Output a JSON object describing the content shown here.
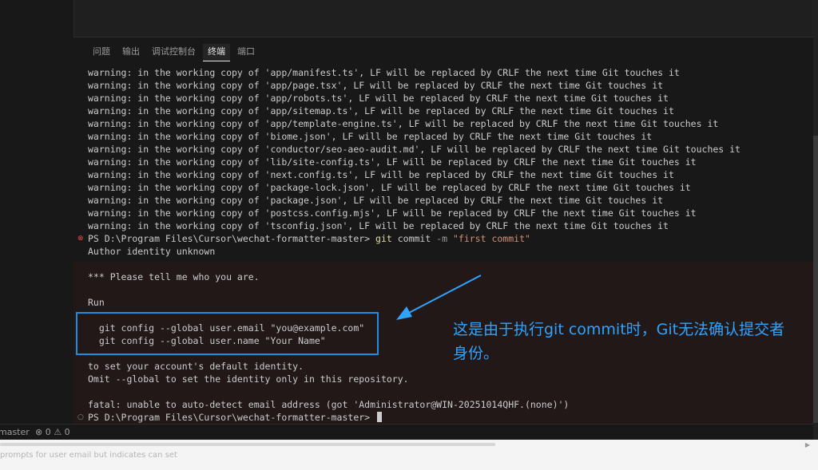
{
  "panel": {
    "tabs": [
      {
        "label": "问题",
        "active": false
      },
      {
        "label": "输出",
        "active": false
      },
      {
        "label": "调试控制台",
        "active": false
      },
      {
        "label": "终端",
        "active": true
      },
      {
        "label": "端口",
        "active": false
      }
    ]
  },
  "terminal": {
    "warnings": [
      "warning: in the working copy of 'app/manifest.ts', LF will be replaced by CRLF the next time Git touches it",
      "warning: in the working copy of 'app/page.tsx', LF will be replaced by CRLF the next time Git touches it",
      "warning: in the working copy of 'app/robots.ts', LF will be replaced by CRLF the next time Git touches it",
      "warning: in the working copy of 'app/sitemap.ts', LF will be replaced by CRLF the next time Git touches it",
      "warning: in the working copy of 'app/template-engine.ts', LF will be replaced by CRLF the next time Git touches it",
      "warning: in the working copy of 'biome.json', LF will be replaced by CRLF the next time Git touches it",
      "warning: in the working copy of 'conductor/seo-aeo-audit.md', LF will be replaced by CRLF the next time Git touches it",
      "warning: in the working copy of 'lib/site-config.ts', LF will be replaced by CRLF the next time Git touches it",
      "warning: in the working copy of 'next.config.ts', LF will be replaced by CRLF the next time Git touches it",
      "warning: in the working copy of 'package-lock.json', LF will be replaced by CRLF the next time Git touches it",
      "warning: in the working copy of 'package.json', LF will be replaced by CRLF the next time Git touches it",
      "warning: in the working copy of 'postcss.config.mjs', LF will be replaced by CRLF the next time Git touches it",
      "warning: in the working copy of 'tsconfig.json', LF will be replaced by CRLF the next time Git touches it"
    ],
    "prompt": "PS D:\\Program Files\\Cursor\\wechat-formatter-master> ",
    "command_git": "git",
    "command_sub": " commit ",
    "command_flag": "-m",
    "command_msg": " \"first commit\"",
    "author_unknown": "Author identity unknown",
    "tell_me": "*** Please tell me who you are.",
    "run": "Run",
    "config_email": "  git config --global user.email \"you@example.com\"",
    "config_name": "  git config --global user.name \"Your Name\"",
    "set_default": "to set your account's default identity.",
    "omit_global": "Omit --global to set the identity only in this repository.",
    "fatal": "fatal: unable to auto-detect email address (got 'Administrator@WIN-20251014QHF.(none)')",
    "prompt_final": "PS D:\\Program Files\\Cursor\\wechat-formatter-master> "
  },
  "annotation": {
    "text": "这是由于执行git commit时，Git无法确认提交者身份。",
    "color": "#2ea4ff"
  },
  "status_bar": {
    "branch": "master",
    "problems": "⊗ 0 ⚠ 0"
  },
  "footer": {
    "text": "prompts for user email but indicates can set"
  }
}
